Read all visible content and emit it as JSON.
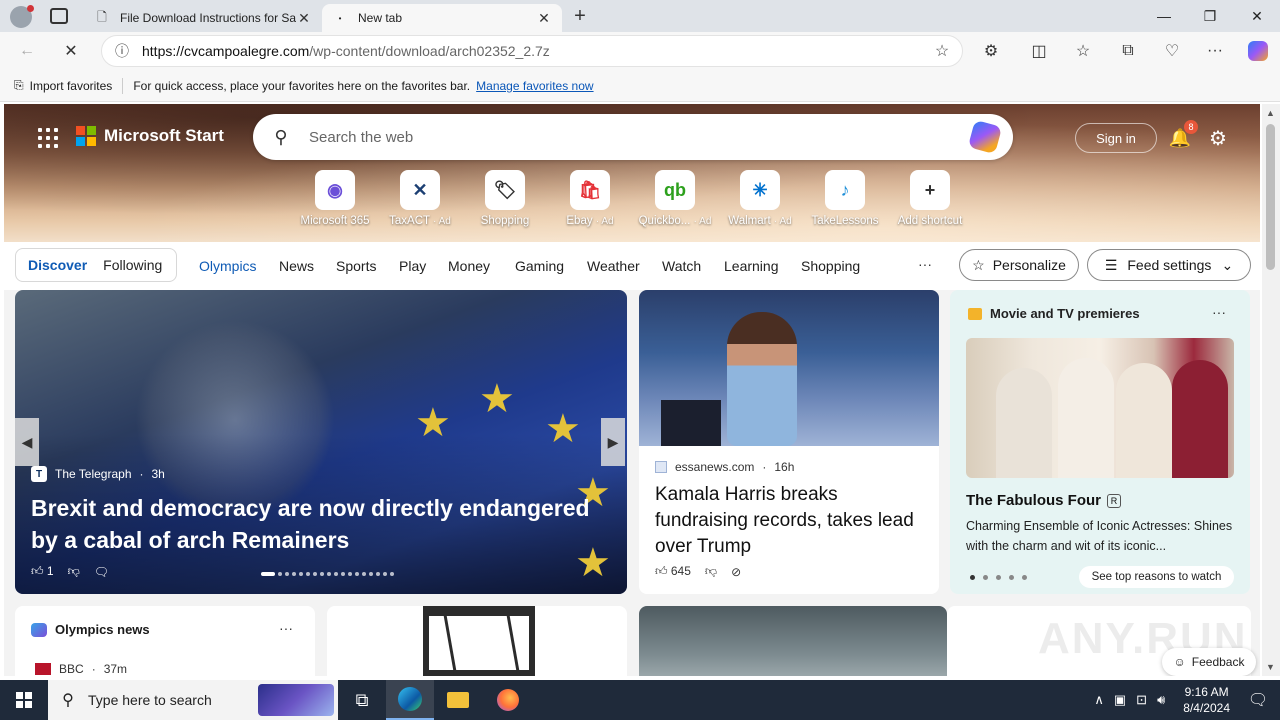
{
  "browser": {
    "tabs": [
      {
        "title": "File Download Instructions for Sa",
        "active": false
      },
      {
        "title": "New tab",
        "active": true
      }
    ],
    "address": {
      "host": "https://cvcampoalegre.com",
      "path": "/wp-content/download/arch02352_2.7z"
    },
    "favorites_bar": {
      "import_label": "Import favorites",
      "message": "For quick access, place your favorites here on the favorites bar.",
      "manage_link": "Manage favorites now"
    }
  },
  "header": {
    "brand": "Microsoft Start",
    "search_placeholder": "Search the web",
    "sign_in": "Sign in",
    "notification_count": "8"
  },
  "shortcuts": [
    {
      "label": "Microsoft 365",
      "ad": "",
      "glyph": "◉",
      "color": "#6b4fd8"
    },
    {
      "label": "TaxACT",
      "ad": "· Ad",
      "glyph": "✕",
      "color": "#1c3f73"
    },
    {
      "label": "Shopping",
      "ad": "",
      "glyph": "🏷",
      "color": "#333333"
    },
    {
      "label": "Ebay",
      "ad": "· Ad",
      "glyph": "🛍",
      "color": "#e53238"
    },
    {
      "label": "Quickbo...",
      "ad": "· Ad",
      "glyph": "qb",
      "color": "#2ca01c"
    },
    {
      "label": "Walmart",
      "ad": "· Ad",
      "glyph": "✳",
      "color": "#0071ce"
    },
    {
      "label": "TakeLessons",
      "ad": "",
      "glyph": "♪",
      "color": "#1d8ed8"
    },
    {
      "label": "Add shortcut",
      "ad": "",
      "glyph": "+",
      "color": "#333333"
    }
  ],
  "feed_nav": {
    "discover": "Discover",
    "following": "Following",
    "links": [
      "Olympics",
      "News",
      "Sports",
      "Play",
      "Money",
      "Gaming",
      "Weather",
      "Watch",
      "Learning",
      "Shopping"
    ],
    "more": "···",
    "personalize": "Personalize",
    "feed_settings": "Feed settings"
  },
  "big_story": {
    "source": "The Telegraph",
    "age": "3h",
    "title": "Brexit and democracy are now directly endangered by a cabal of arch Remainers",
    "likes": "1"
  },
  "kamala_story": {
    "source": "essanews.com",
    "age": "16h",
    "title": "Kamala Harris breaks fundraising records, takes lead over Trump",
    "likes": "645"
  },
  "movie_card": {
    "header": "Movie and TV premieres",
    "title": "The Fabulous Four",
    "rating": "R",
    "description": "Charming Ensemble of Iconic Actresses: Shines with the charm and wit of its iconic...",
    "cta": "See top reasons to watch"
  },
  "olympics_card": {
    "header": "Olympics news",
    "first_source": "BBC",
    "first_age": "37m"
  },
  "feedback": "Feedback",
  "watermark": "ANY.RUN",
  "taskbar": {
    "search_placeholder": "Type here to search",
    "time": "9:16 AM",
    "date": "8/4/2024"
  }
}
